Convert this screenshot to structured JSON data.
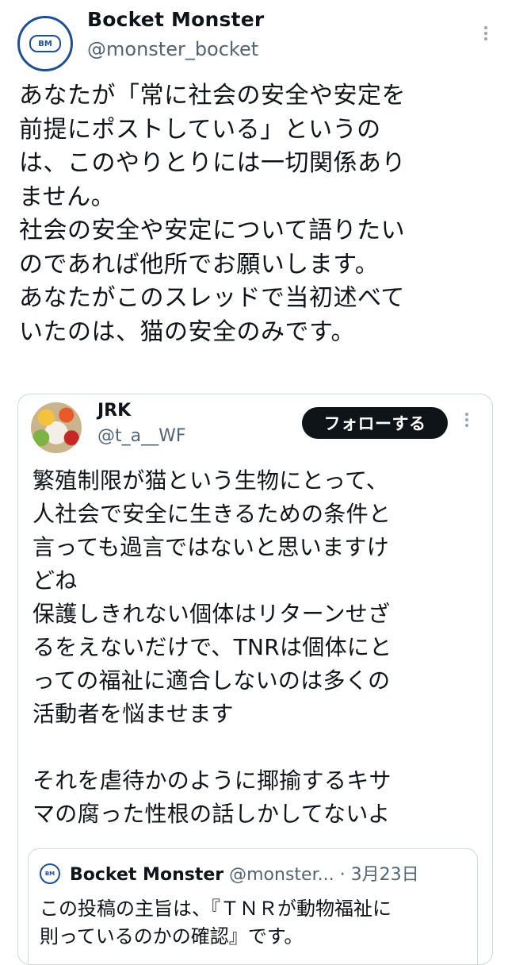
{
  "post": {
    "author_name": "Bocket Monster",
    "author_handle": "@monster_bocket",
    "avatar_text": "BM",
    "text": "あなたが「常に社会の安全や安定を\n前提にポストしている」というの\nは、このやりとりには一切関係あり\nません。\n社会の安全や安定について語りたい\nのであれば他所でお願いします。\nあなたがこのスレッドで当初述べて\nいたのは、猫の安全のみです。"
  },
  "quote": {
    "author_name": "JRK",
    "author_handle": "@t_a__WF",
    "follow_label": "フォローする",
    "text": "繁殖制限が猫という生物にとって、\n人社会で安全に生きるための条件と\n言っても過言ではないと思いますけ\nどね\n保護しきれない個体はリターンせざ\nるをえないだけで、TNRは個体にと\nっての福祉に適合しないのは多くの\n活動者を悩ませます\n\nそれを虐待かのように揶揄するキサ\nマの腐った性根の話しかしてないよ"
  },
  "nested_quote": {
    "avatar_text": "BM",
    "author_name": "Bocket Monster",
    "author_handle": "@monster...",
    "separator": " · ",
    "date": "3月23日",
    "text": "この投稿の主旨は、『ＴＮＲが動物福祉に\n則っているのかの確認』です。"
  },
  "colors": {
    "text": "#0f1419",
    "secondary": "#536471",
    "border": "#cfd9de",
    "brand_blue": "#1d4f91",
    "button_bg": "#0f1419"
  },
  "icons": [
    "more-options-icon",
    "bm-logo-icon"
  ]
}
